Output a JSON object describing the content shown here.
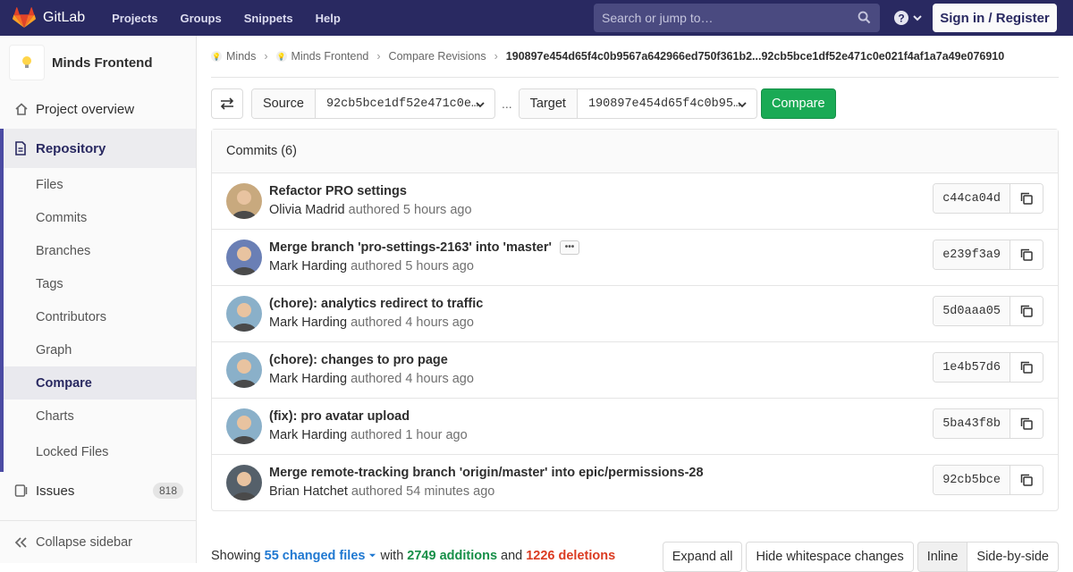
{
  "navbar": {
    "brand": "GitLab",
    "links": [
      "Projects",
      "Groups",
      "Snippets",
      "Help"
    ],
    "search_placeholder": "Search or jump to…",
    "signin": "Sign in / Register"
  },
  "sidebar": {
    "project_name": "Minds Frontend",
    "overview": "Project overview",
    "repository": "Repository",
    "repo_items": [
      "Files",
      "Commits",
      "Branches",
      "Tags",
      "Contributors",
      "Graph",
      "Compare",
      "Charts",
      "Locked Files"
    ],
    "active_item": "Compare",
    "issues": "Issues",
    "issues_count": "818",
    "collapse": "Collapse sidebar"
  },
  "breadcrumb": {
    "items": [
      "Minds",
      "Minds Frontend",
      "Compare Revisions"
    ],
    "current": "190897e454d65f4c0b9567a642966ed750f361b2...92cb5bce1df52e471c0e021f4af1a7a49e076910"
  },
  "compare": {
    "source_label": "Source",
    "source_value": "92cb5bce1df52e471c0e…",
    "dots": "...",
    "target_label": "Target",
    "target_value": "190897e454d65f4c0b95…",
    "button": "Compare"
  },
  "commits": {
    "header": "Commits (6)",
    "authored": "authored",
    "rows": [
      {
        "title": "Refactor PRO settings",
        "author": "Olivia Madrid",
        "time": "5 hours ago",
        "sha": "c44ca04d",
        "avatar_color": "#c8a97e",
        "has_more": false
      },
      {
        "title": "Merge branch 'pro-settings-2163' into 'master'",
        "author": "Mark Harding",
        "time": "5 hours ago",
        "sha": "e239f3a9",
        "avatar_color": "#6a7fb5",
        "has_more": true
      },
      {
        "title": "(chore): analytics redirect to traffic",
        "author": "Mark Harding",
        "time": "4 hours ago",
        "sha": "5d0aaa05",
        "avatar_color": "#8ab0c9",
        "has_more": false
      },
      {
        "title": "(chore): changes to pro page",
        "author": "Mark Harding",
        "time": "4 hours ago",
        "sha": "1e4b57d6",
        "avatar_color": "#8ab0c9",
        "has_more": false
      },
      {
        "title": "(fix): pro avatar upload",
        "author": "Mark Harding",
        "time": "1 hour ago",
        "sha": "5ba43f8b",
        "avatar_color": "#8ab0c9",
        "has_more": false
      },
      {
        "title": "Merge remote-tracking branch 'origin/master' into epic/permissions-28",
        "author": "Brian Hatchet",
        "time": "54 minutes ago",
        "sha": "92cb5bce",
        "avatar_color": "#55606a",
        "has_more": false
      }
    ]
  },
  "stats": {
    "showing": "Showing",
    "files": "55 changed files",
    "with": "with",
    "additions": "2749 additions",
    "and": "and",
    "deletions": "1226 deletions"
  },
  "diff_buttons": {
    "expand": "Expand all",
    "whitespace": "Hide whitespace changes",
    "inline": "Inline",
    "side": "Side-by-side"
  },
  "colors": {
    "navbar": "#292961",
    "compare_button": "#1aaa55",
    "additions": "#168f48",
    "deletions": "#db3b21",
    "link": "#1f78d1"
  }
}
